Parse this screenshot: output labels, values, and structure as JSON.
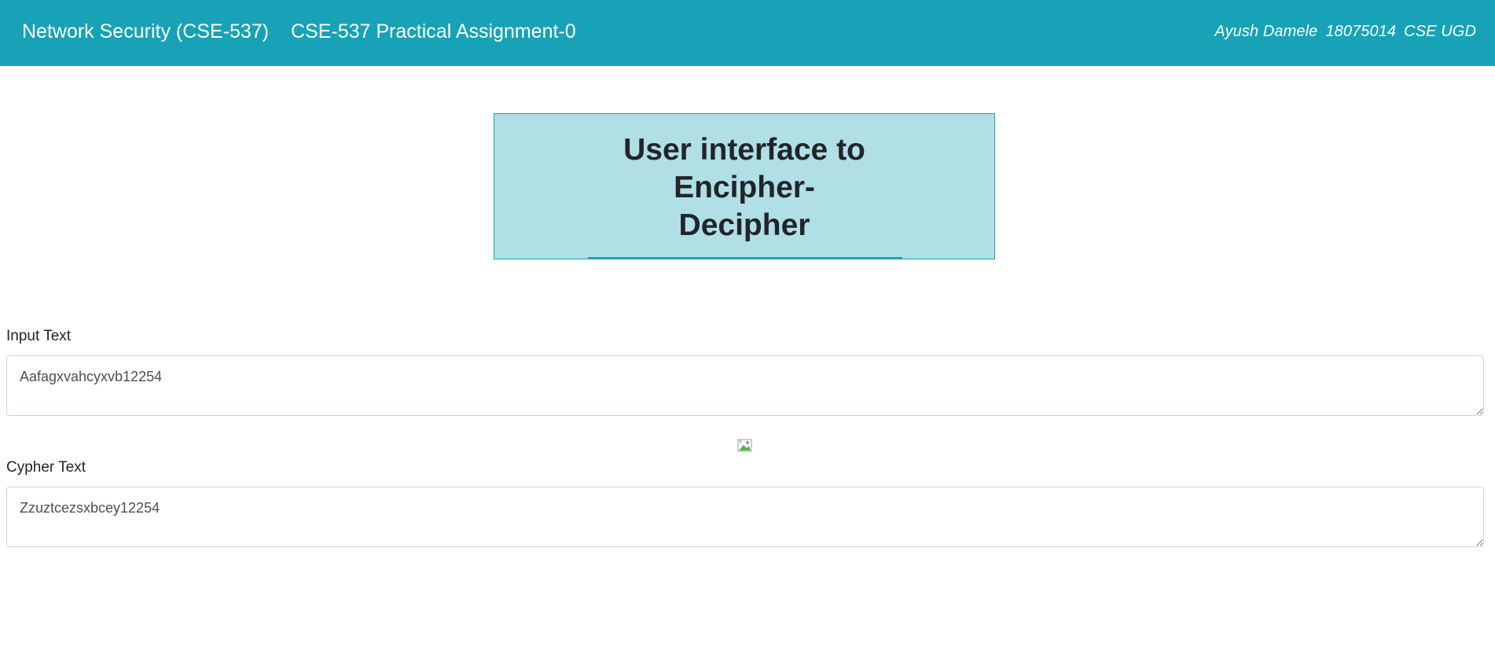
{
  "navbar": {
    "brand": "Network Security (CSE-537)",
    "link": "CSE-537 Practical Assignment-0",
    "author": {
      "name": "Ayush Damele",
      "roll": "18075014",
      "dept": "CSE UGD"
    },
    "bg_color": "#17a2b8"
  },
  "title": {
    "line1": "User interface to",
    "line2": "Encipher-",
    "line3": "Decipher"
  },
  "input": {
    "label": "Input Text",
    "value": "Aafagxvahcyxvb12254"
  },
  "output": {
    "label": "Cypher Text",
    "value": "Zzuztcezsxbcey12254"
  },
  "icons": {
    "broken_image": "broken-image-icon"
  }
}
